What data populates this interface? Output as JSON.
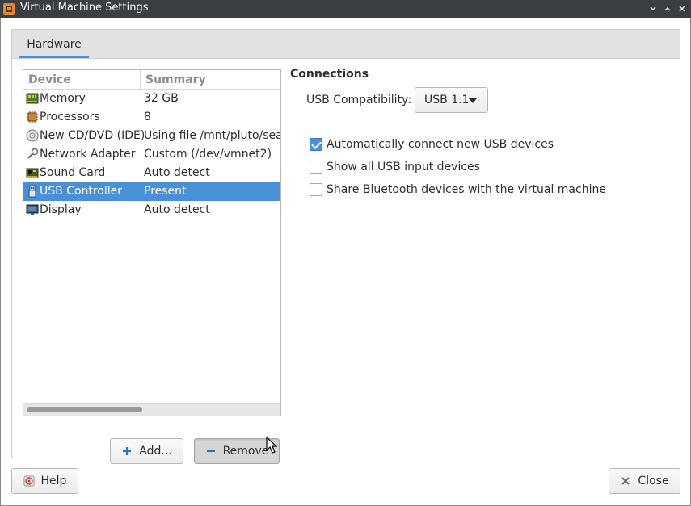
{
  "window": {
    "title": "Virtual Machine Settings"
  },
  "tabs": [
    {
      "label": "Hardware",
      "active": true
    }
  ],
  "device_list": {
    "columns": [
      "Device",
      "Summary"
    ],
    "rows": [
      {
        "icon": "memory-icon",
        "device": "Memory",
        "summary": "32 GB",
        "selected": false
      },
      {
        "icon": "processor-icon",
        "device": "Processors",
        "summary": "8",
        "selected": false
      },
      {
        "icon": "cd-dvd-icon",
        "device": "New CD/DVD (IDE)",
        "summary": "Using file /mnt/pluto/seagate",
        "selected": false
      },
      {
        "icon": "network-adapter-icon",
        "device": "Network Adapter",
        "summary": "Custom (/dev/vmnet2)",
        "selected": false
      },
      {
        "icon": "sound-card-icon",
        "device": "Sound Card",
        "summary": "Auto detect",
        "selected": false
      },
      {
        "icon": "usb-icon",
        "device": "USB Controller",
        "summary": "Present",
        "selected": true
      },
      {
        "icon": "display-icon",
        "device": "Display",
        "summary": "Auto detect",
        "selected": false
      }
    ]
  },
  "buttons": {
    "add": "Add...",
    "remove": "Remove",
    "help": "Help",
    "close": "Close"
  },
  "connections": {
    "title": "Connections",
    "usb_compat_label": "USB Compatibility:",
    "usb_compat_value": "USB 1.1",
    "options": [
      {
        "label": "Automatically connect new USB devices",
        "checked": true
      },
      {
        "label": "Show all USB input devices",
        "checked": false
      },
      {
        "label": "Share Bluetooth devices with the virtual machine",
        "checked": false
      }
    ]
  },
  "colors": {
    "accent": "#4a90d9",
    "titlebar": "#3b3f44"
  }
}
